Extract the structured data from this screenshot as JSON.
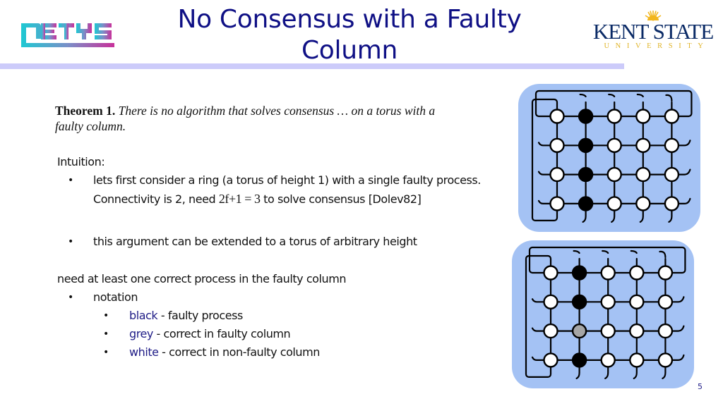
{
  "header": {
    "title": "No Consensus with a Faulty Column",
    "title_line1": "No Consensus with a Faulty",
    "title_line2": "Column",
    "left_logo": "NETYS",
    "right_logo_main": "KENT STATE",
    "right_logo_sub": "UNIVERSITY",
    "accent_bar_color": "#cccbfa",
    "title_color": "#0f1085"
  },
  "theorem": {
    "label": "Theorem 1.",
    "statement_line1": "There is no algorithm that solves consensus … on a torus with a",
    "statement_line2": "faulty column."
  },
  "body": {
    "intuition_label": "Intuition:",
    "bullets": [
      {
        "line1": "lets first consider a ring (a torus of height 1) with a single faulty process.",
        "line2_prefix": "Connectivity is 2, need ",
        "line2_math": "2f+1 = 3",
        "line2_suffix": " to solve consensus [Dolev82]"
      },
      {
        "line1": "this argument can be extended to a torus of arbitrary height"
      }
    ],
    "requirement": "need at least one correct process in the faulty column",
    "notation_label": "notation",
    "notation_items": [
      {
        "term": "black",
        "desc": " - faulty process"
      },
      {
        "term": "grey",
        "desc": " - correct in faulty column"
      },
      {
        "term": "white",
        "desc": " - correct in non-faulty column"
      }
    ],
    "bullet_char": "•"
  },
  "diagrams": [
    {
      "name": "torus-all-faulty-column",
      "rows": 4,
      "cols": 5,
      "faulty_column": 2,
      "node_states": [
        [
          "white",
          "black",
          "white",
          "white",
          "white"
        ],
        [
          "white",
          "black",
          "white",
          "white",
          "white"
        ],
        [
          "white",
          "black",
          "white",
          "white",
          "white"
        ],
        [
          "white",
          "black",
          "white",
          "white",
          "white"
        ]
      ]
    },
    {
      "name": "torus-faulty-column-one-correct",
      "rows": 4,
      "cols": 5,
      "faulty_column": 2,
      "node_states": [
        [
          "white",
          "black",
          "white",
          "white",
          "white"
        ],
        [
          "white",
          "black",
          "white",
          "white",
          "white"
        ],
        [
          "white",
          "grey",
          "white",
          "white",
          "white"
        ],
        [
          "white",
          "black",
          "white",
          "white",
          "white"
        ]
      ]
    }
  ],
  "colors": {
    "panel": "#a4c2f4",
    "black": "#000000",
    "grey": "#a6a6a6",
    "white": "#ffffff",
    "term_blue": "#1e1b86"
  },
  "footer": {
    "page_number": "5"
  }
}
